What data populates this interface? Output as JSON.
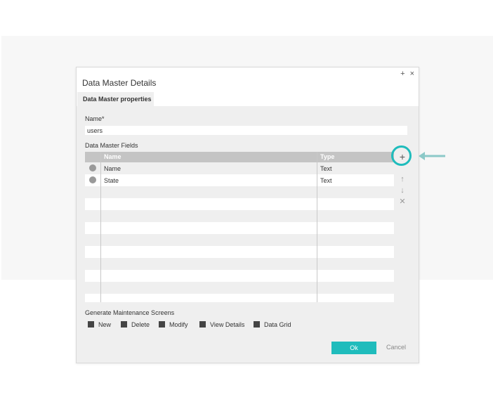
{
  "dialog": {
    "title": "Data Master Details",
    "maximize_glyph": "+",
    "close_glyph": "×",
    "tab_label": "Data Master properties"
  },
  "form": {
    "name_label": "Name*",
    "name_value": "users",
    "fields_label": "Data Master Fields"
  },
  "grid": {
    "columns": [
      "Name",
      "Type"
    ],
    "rows": [
      {
        "name": "Name",
        "type": "Text"
      },
      {
        "name": "State",
        "type": "Text"
      }
    ]
  },
  "tools": {
    "add_glyph": "+",
    "up_glyph": "↑",
    "down_glyph": "↓",
    "remove_glyph": "✕"
  },
  "maintenance": {
    "label": "Generate Maintenance Screens",
    "options": [
      "New",
      "Delete",
      "Modify",
      "View Details",
      "Data Grid"
    ]
  },
  "buttons": {
    "ok": "Ok",
    "cancel": "Cancel"
  },
  "colors": {
    "accent": "#1fbcbc",
    "arrow": "#8cc9c8"
  }
}
